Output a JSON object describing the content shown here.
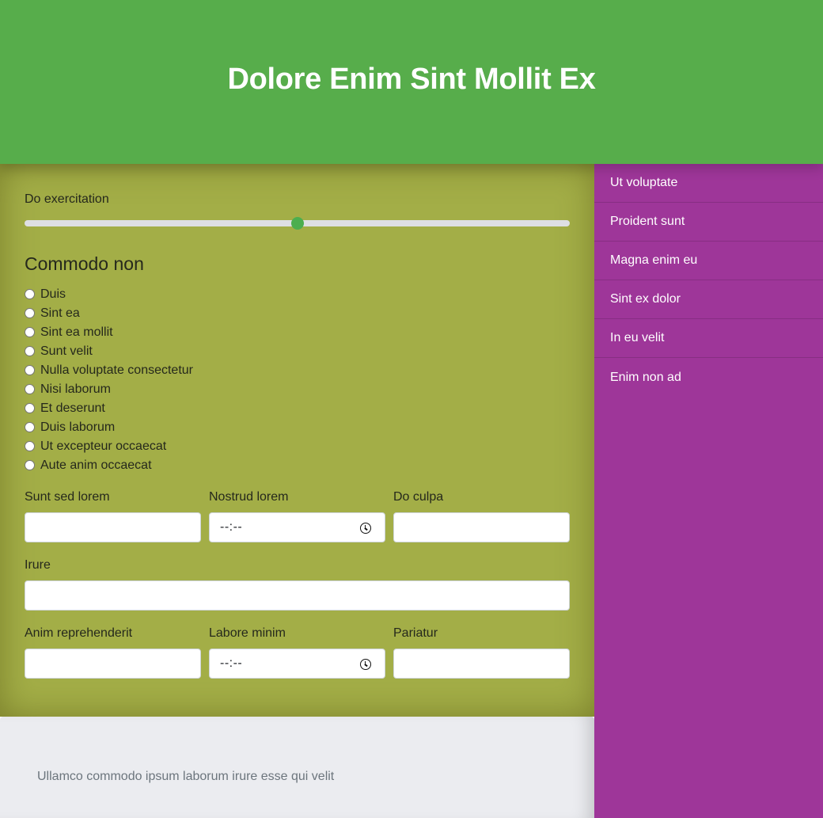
{
  "header": {
    "title": "Dolore Enim Sint Mollit Ex"
  },
  "slider": {
    "label": "Do exercitation",
    "value_percent": 50
  },
  "radio_group": {
    "title": "Commodo non",
    "options": [
      "Duis",
      "Sint ea",
      "Sint ea mollit",
      "Sunt velit",
      "Nulla voluptate consectetur",
      "Nisi laborum",
      "Et deserunt",
      "Duis laborum",
      "Ut excepteur occaecat",
      "Aute anim occaecat"
    ]
  },
  "form": {
    "row1": {
      "field1_label": "Sunt sed lorem",
      "field2_label": "Nostrud lorem",
      "field2_value": "--:--",
      "field3_label": "Do culpa"
    },
    "row2": {
      "field1_label": "Irure"
    },
    "row3": {
      "field1_label": "Anim reprehenderit",
      "field2_label": "Labore minim",
      "field2_value": "--:--",
      "field3_label": "Pariatur"
    }
  },
  "footer": {
    "text": "Ullamco commodo ipsum laborum irure esse qui velit"
  },
  "sidebar": {
    "items": [
      {
        "label": "Ut voluptate"
      },
      {
        "label": "Proident sunt"
      },
      {
        "label": "Magna enim eu"
      },
      {
        "label": "Sint ex dolor"
      },
      {
        "label": "In eu velit"
      },
      {
        "label": "Enim non ad"
      }
    ]
  },
  "colors": {
    "header_bg": "#57ad4b",
    "main_bg": "#a3ae47",
    "sidebar_bg": "#9e3699",
    "footer_bg": "#ebecf0",
    "accent": "#4cae4f"
  }
}
